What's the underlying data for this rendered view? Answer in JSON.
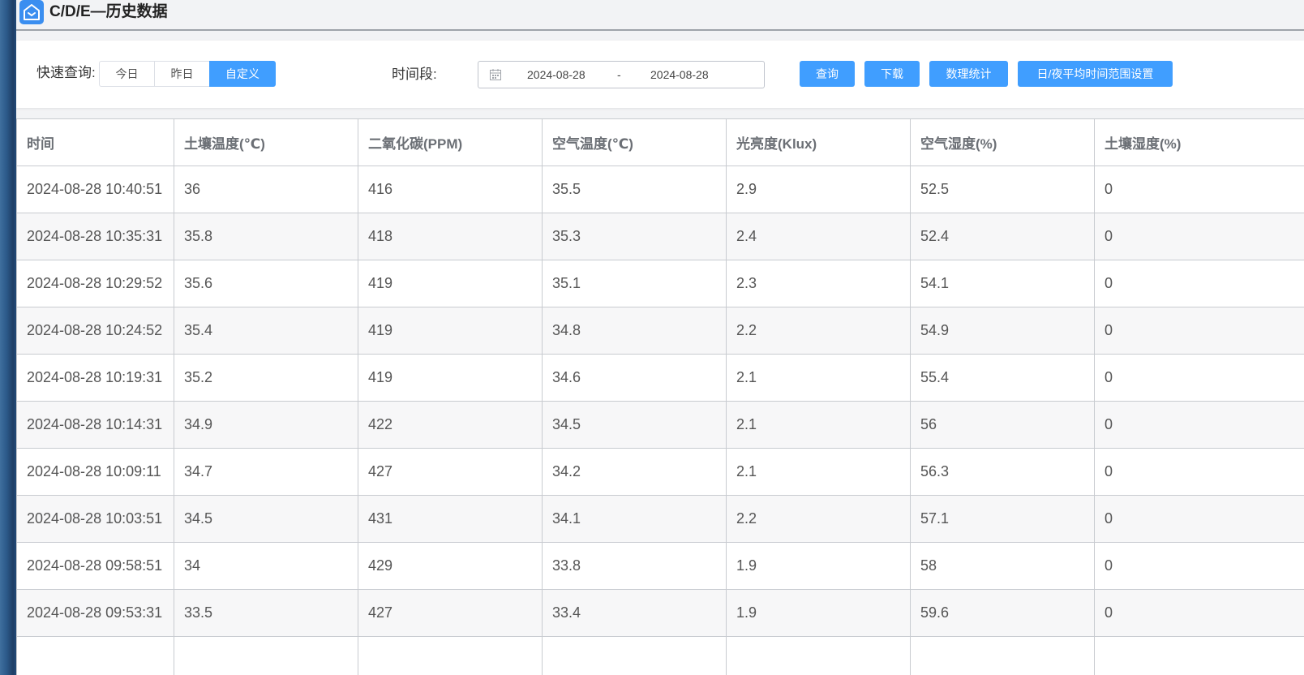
{
  "header": {
    "title": "C/D/E—历史数据",
    "logo_icon": "home-icon",
    "accent": "#3a8ef0"
  },
  "filters": {
    "quick_label": "快速查询:",
    "quick_options": [
      "今日",
      "昨日",
      "自定义"
    ],
    "quick_selected": "自定义",
    "period_label": "时间段:",
    "date_start": "2024-08-28",
    "date_separator": "-",
    "date_end": "2024-08-28",
    "buttons": {
      "query": "查询",
      "download": "下载",
      "stats": "数理统计",
      "day_night": "日/夜平均时间范围设置"
    },
    "button_color": "#409eff"
  },
  "table": {
    "columns": [
      "时间",
      "土壤温度(℃)",
      "二氧化碳(PPM)",
      "空气温度(℃)",
      "光亮度(Klux)",
      "空气湿度(%)",
      "土壤湿度(%)"
    ],
    "rows": [
      [
        "2024-08-28 10:40:51",
        "36",
        "416",
        "35.5",
        "2.9",
        "52.5",
        "0"
      ],
      [
        "2024-08-28 10:35:31",
        "35.8",
        "418",
        "35.3",
        "2.4",
        "52.4",
        "0"
      ],
      [
        "2024-08-28 10:29:52",
        "35.6",
        "419",
        "35.1",
        "2.3",
        "54.1",
        "0"
      ],
      [
        "2024-08-28 10:24:52",
        "35.4",
        "419",
        "34.8",
        "2.2",
        "54.9",
        "0"
      ],
      [
        "2024-08-28 10:19:31",
        "35.2",
        "419",
        "34.6",
        "2.1",
        "55.4",
        "0"
      ],
      [
        "2024-08-28 10:14:31",
        "34.9",
        "422",
        "34.5",
        "2.1",
        "56",
        "0"
      ],
      [
        "2024-08-28 10:09:11",
        "34.7",
        "427",
        "34.2",
        "2.1",
        "56.3",
        "0"
      ],
      [
        "2024-08-28 10:03:51",
        "34.5",
        "431",
        "34.1",
        "2.2",
        "57.1",
        "0"
      ],
      [
        "2024-08-28 09:58:51",
        "34",
        "429",
        "33.8",
        "1.9",
        "58",
        "0"
      ],
      [
        "2024-08-28 09:53:31",
        "33.5",
        "427",
        "33.4",
        "1.9",
        "59.6",
        "0"
      ],
      [
        "",
        "",
        "",
        "",
        "",
        "",
        ""
      ]
    ]
  }
}
